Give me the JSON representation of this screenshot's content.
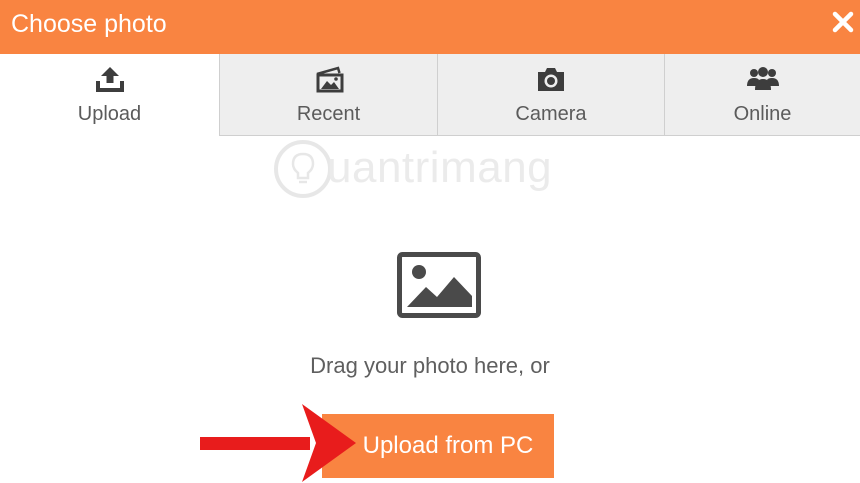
{
  "dialog": {
    "title": "Choose photo",
    "close_icon": "close-icon",
    "accent_color": "#f98441"
  },
  "tabs": [
    {
      "label": "Upload",
      "icon": "upload-icon",
      "active": true
    },
    {
      "label": "Recent",
      "icon": "recent-photos-icon",
      "active": false
    },
    {
      "label": "Camera",
      "icon": "camera-icon",
      "active": false
    },
    {
      "label": "Online",
      "icon": "online-users-icon",
      "active": false
    }
  ],
  "watermark": {
    "text": "uantrimang",
    "icon": "lightbulb-logo-icon"
  },
  "upload_panel": {
    "image_icon": "image-placeholder-icon",
    "drag_text": "Drag your photo here, or",
    "button_label": "Upload from PC",
    "pointer_icon": "red-arrow-icon",
    "pointer_color": "#e81c1c"
  }
}
